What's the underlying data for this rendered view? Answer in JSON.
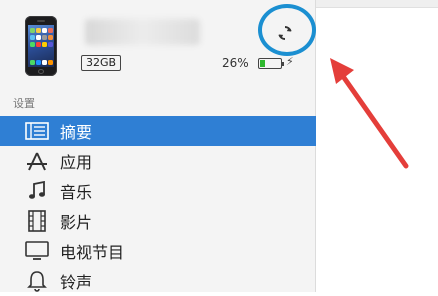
{
  "device": {
    "capacity": "32GB",
    "battery_percent": "26%",
    "battery_level": 0.26
  },
  "sync_button": {
    "icon": "sync-icon"
  },
  "sidebar": {
    "section_title": "设置",
    "items": [
      {
        "label": "摘要",
        "icon": "summary-icon",
        "selected": true
      },
      {
        "label": "应用",
        "icon": "apps-icon",
        "selected": false
      },
      {
        "label": "音乐",
        "icon": "music-note-icon",
        "selected": false
      },
      {
        "label": "影片",
        "icon": "film-icon",
        "selected": false
      },
      {
        "label": "电视节目",
        "icon": "tv-icon",
        "selected": false
      },
      {
        "label": "铃声",
        "icon": "bell-icon",
        "selected": false
      }
    ]
  },
  "colors": {
    "selected_bg": "#2f7fd4",
    "highlight_circle": "#1b8fd1",
    "arrow": "#e43e3a",
    "battery_fill": "#2eb82e"
  }
}
